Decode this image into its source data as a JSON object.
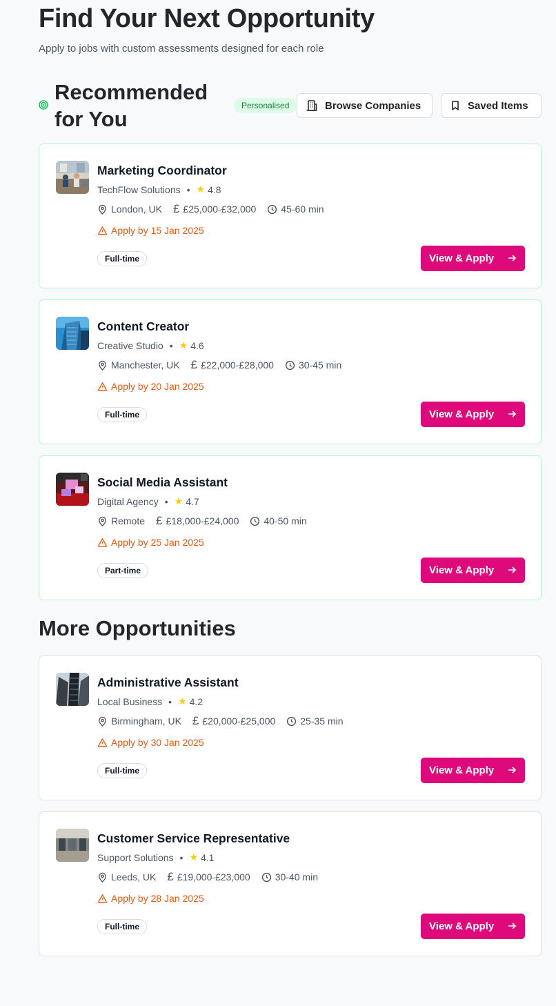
{
  "header": {
    "title": "Find Your Next Opportunity",
    "subtitle": "Apply to jobs with custom assessments designed for each role"
  },
  "recommended": {
    "title": "Recommended for You",
    "badge": "Personalised",
    "browse_label": "Browse Companies",
    "saved_label": "Saved Items",
    "jobs": [
      {
        "title": "Marketing Coordinator",
        "company": "TechFlow Solutions",
        "rating": "4.8",
        "location": "London, UK",
        "salary": "£25,000-£32,000",
        "duration": "45-60 min",
        "deadline": "Apply by 15 Jan 2025",
        "type": "Full-time",
        "apply_label": "View & Apply",
        "logo_icon": "office-photo-logo"
      },
      {
        "title": "Content Creator",
        "company": "Creative Studio",
        "rating": "4.6",
        "location": "Manchester, UK",
        "salary": "£22,000-£28,000",
        "duration": "30-45 min",
        "deadline": "Apply by 20 Jan 2025",
        "type": "Full-time",
        "apply_label": "View & Apply",
        "logo_icon": "glass-building-logo"
      },
      {
        "title": "Social Media Assistant",
        "company": "Digital Agency",
        "rating": "4.7",
        "location": "Remote",
        "salary": "£18,000-£24,000",
        "duration": "40-50 min",
        "deadline": "Apply by 25 Jan 2025",
        "type": "Part-time",
        "apply_label": "View & Apply",
        "logo_icon": "red-studio-logo"
      }
    ]
  },
  "more": {
    "title": "More Opportunities",
    "jobs": [
      {
        "title": "Administrative Assistant",
        "company": "Local Business",
        "rating": "4.2",
        "location": "Birmingham, UK",
        "salary": "£20,000-£25,000",
        "duration": "25-35 min",
        "deadline": "Apply by 30 Jan 2025",
        "type": "Full-time",
        "apply_label": "View & Apply",
        "logo_icon": "skyscraper-logo"
      },
      {
        "title": "Customer Service Representative",
        "company": "Support Solutions",
        "rating": "4.1",
        "location": "Leeds, UK",
        "salary": "£19,000-£23,000",
        "duration": "30-40 min",
        "deadline": "Apply by 28 Jan 2025",
        "type": "Full-time",
        "apply_label": "View & Apply",
        "logo_icon": "lobby-interior-logo"
      }
    ]
  },
  "colors": {
    "accent": "#de0a7c",
    "deadline": "#ea580c",
    "star": "#facc15",
    "personalised_bg": "#dcfce7",
    "personalised_text": "#15803d",
    "recommended_border": "#bbf2cf"
  }
}
